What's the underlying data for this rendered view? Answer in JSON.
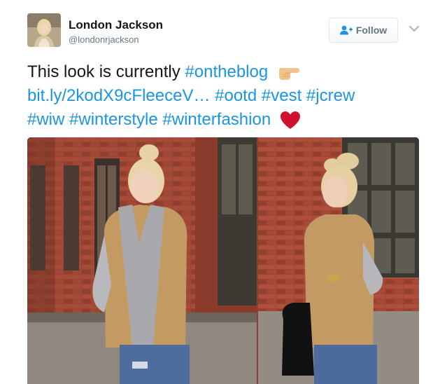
{
  "user": {
    "name": "London Jackson",
    "handle": "@londonrjackson",
    "avatar_icon": "profile-photo"
  },
  "follow_button": {
    "label": "Follow",
    "icon": "add-user-icon"
  },
  "menu_icon": "chevron-down-icon",
  "tweet": {
    "lead_text": "This look is currently",
    "hashtag_ontheblog": "#ontheblog",
    "link_text": "bit.ly/2kodX9cFleeceV…",
    "hashtag_ootd": "#ootd",
    "hashtag_vest": "#vest",
    "hashtag_jcrew": "#jcrew",
    "hashtag_wiw": "#wiw",
    "hashtag_winterstyle": "#winterstyle",
    "hashtag_winterfashion": "#winterfashion",
    "emoji_point": "pointing-hand-emoji",
    "emoji_heart": "red-heart-emoji"
  },
  "colors": {
    "link": "#1b95e0",
    "text": "#14171a",
    "muted": "#657786",
    "heart": "#d0112b",
    "brick": "#8c3e2c"
  }
}
